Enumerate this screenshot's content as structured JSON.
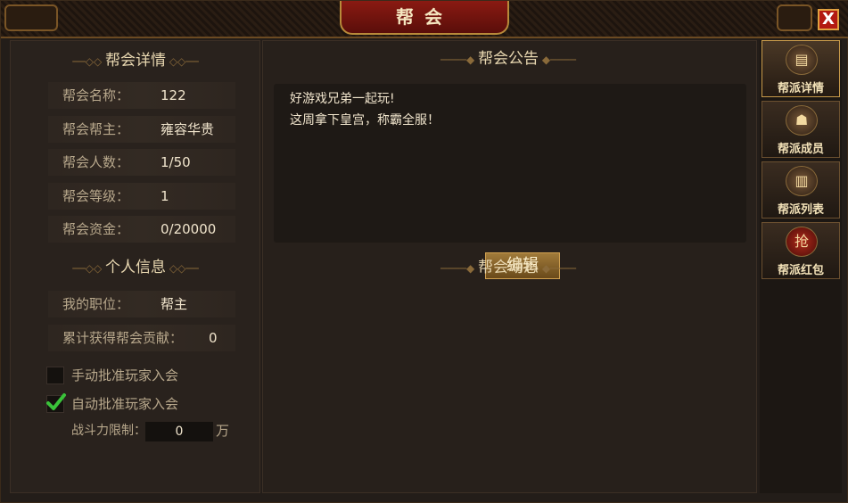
{
  "window": {
    "title": "帮会",
    "close_label": "X"
  },
  "guild_details": {
    "heading": "帮会详情",
    "fields": [
      {
        "label": "帮会名称：",
        "value": "122"
      },
      {
        "label": "帮会帮主：",
        "value": "雍容华贵"
      },
      {
        "label": "帮会人数：",
        "value": "1/50"
      },
      {
        "label": "帮会等级：",
        "value": "1"
      },
      {
        "label": "帮会资金：",
        "value": "0/20000"
      }
    ]
  },
  "personal_info": {
    "heading": "个人信息",
    "position_label": "我的职位：",
    "position_value": "帮主",
    "contribution_label": "累计获得帮会贡献：",
    "contribution_value": "0"
  },
  "options": {
    "manual_approve_label": "手动批准玩家入会",
    "manual_approve_checked": false,
    "auto_approve_label": "自动批准玩家入会",
    "auto_approve_checked": true,
    "power_limit_label": "战斗力限制：",
    "power_limit_value": "0",
    "power_limit_unit": "万"
  },
  "announcement": {
    "heading": "帮会公告",
    "lines": [
      "好游戏兄弟一起玩!",
      "这周拿下皇宫，称霸全服！"
    ],
    "edit_label": "编辑"
  },
  "activity": {
    "heading": "帮会动态"
  },
  "tabs": [
    {
      "label": "帮派详情",
      "icon": "book-icon",
      "active": true
    },
    {
      "label": "帮派成员",
      "icon": "warrior-icon",
      "active": false
    },
    {
      "label": "帮派列表",
      "icon": "scroll-icon",
      "active": false
    },
    {
      "label": "帮派红包",
      "icon": "red-envelope-icon",
      "glyph": "抢",
      "active": false
    }
  ],
  "colors": {
    "accent_gold": "#c89a4a",
    "title_red": "#8a1a12",
    "check_green": "#3ac23a"
  }
}
